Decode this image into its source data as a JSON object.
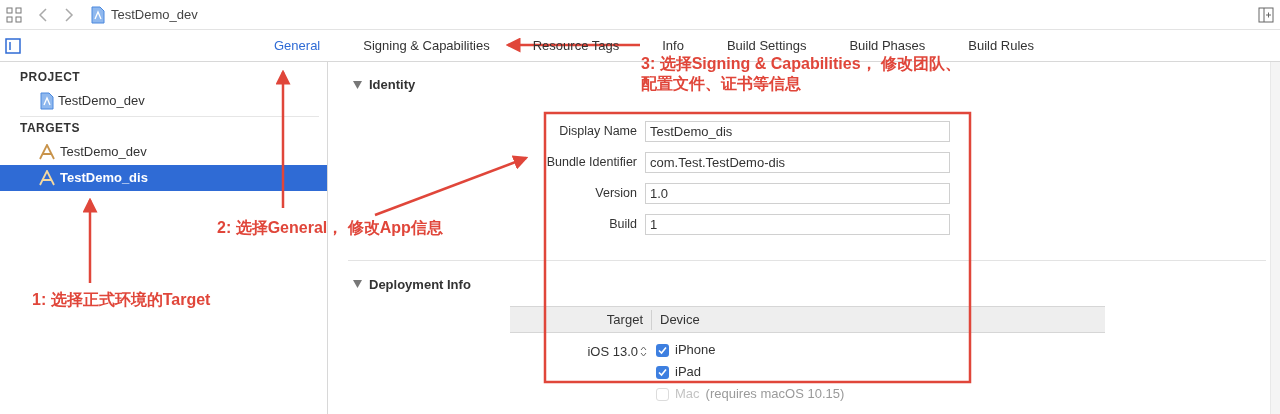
{
  "toolbar": {
    "title": "TestDemo_dev"
  },
  "tabs": [
    {
      "label": "General",
      "selected": true
    },
    {
      "label": "Signing & Capabilities",
      "selected": false
    },
    {
      "label": "Resource Tags",
      "selected": false
    },
    {
      "label": "Info",
      "selected": false
    },
    {
      "label": "Build Settings",
      "selected": false
    },
    {
      "label": "Build Phases",
      "selected": false
    },
    {
      "label": "Build Rules",
      "selected": false
    }
  ],
  "sidebar": {
    "sections": [
      {
        "heading": "PROJECT",
        "items": [
          {
            "label": "TestDemo_dev",
            "kind": "project",
            "selected": false
          }
        ]
      },
      {
        "heading": "TARGETS",
        "items": [
          {
            "label": "TestDemo_dev",
            "kind": "target",
            "selected": false
          },
          {
            "label": "TestDemo_dis",
            "kind": "target",
            "selected": true
          }
        ]
      }
    ]
  },
  "identity": {
    "title": "Identity",
    "expanded": true,
    "fields": [
      {
        "label": "Display Name",
        "value": "TestDemo_dis"
      },
      {
        "label": "Bundle Identifier",
        "value": "com.Test.TestDemo-dis"
      },
      {
        "label": "Version",
        "value": "1.0"
      },
      {
        "label": "Build",
        "value": "1"
      }
    ]
  },
  "deployment": {
    "title": "Deployment Info",
    "expanded": true,
    "columns": [
      "Target",
      "Device"
    ],
    "target": "iOS 13.0",
    "devices": [
      {
        "label": "iPhone",
        "checked": true,
        "disabled": false
      },
      {
        "label": "iPad",
        "checked": true,
        "disabled": false
      },
      {
        "label": "Mac",
        "note": "(requires macOS 10.15)",
        "checked": false,
        "disabled": true
      }
    ]
  },
  "annotations": [
    {
      "lines": [
        "3: 选择Signing & Capabilities， 修改团队、",
        "配置文件、证书等信息"
      ]
    },
    {
      "lines": [
        "2: 选择General， 修改App信息"
      ]
    },
    {
      "lines": [
        "1: 选择正式环境的Target"
      ]
    }
  ]
}
